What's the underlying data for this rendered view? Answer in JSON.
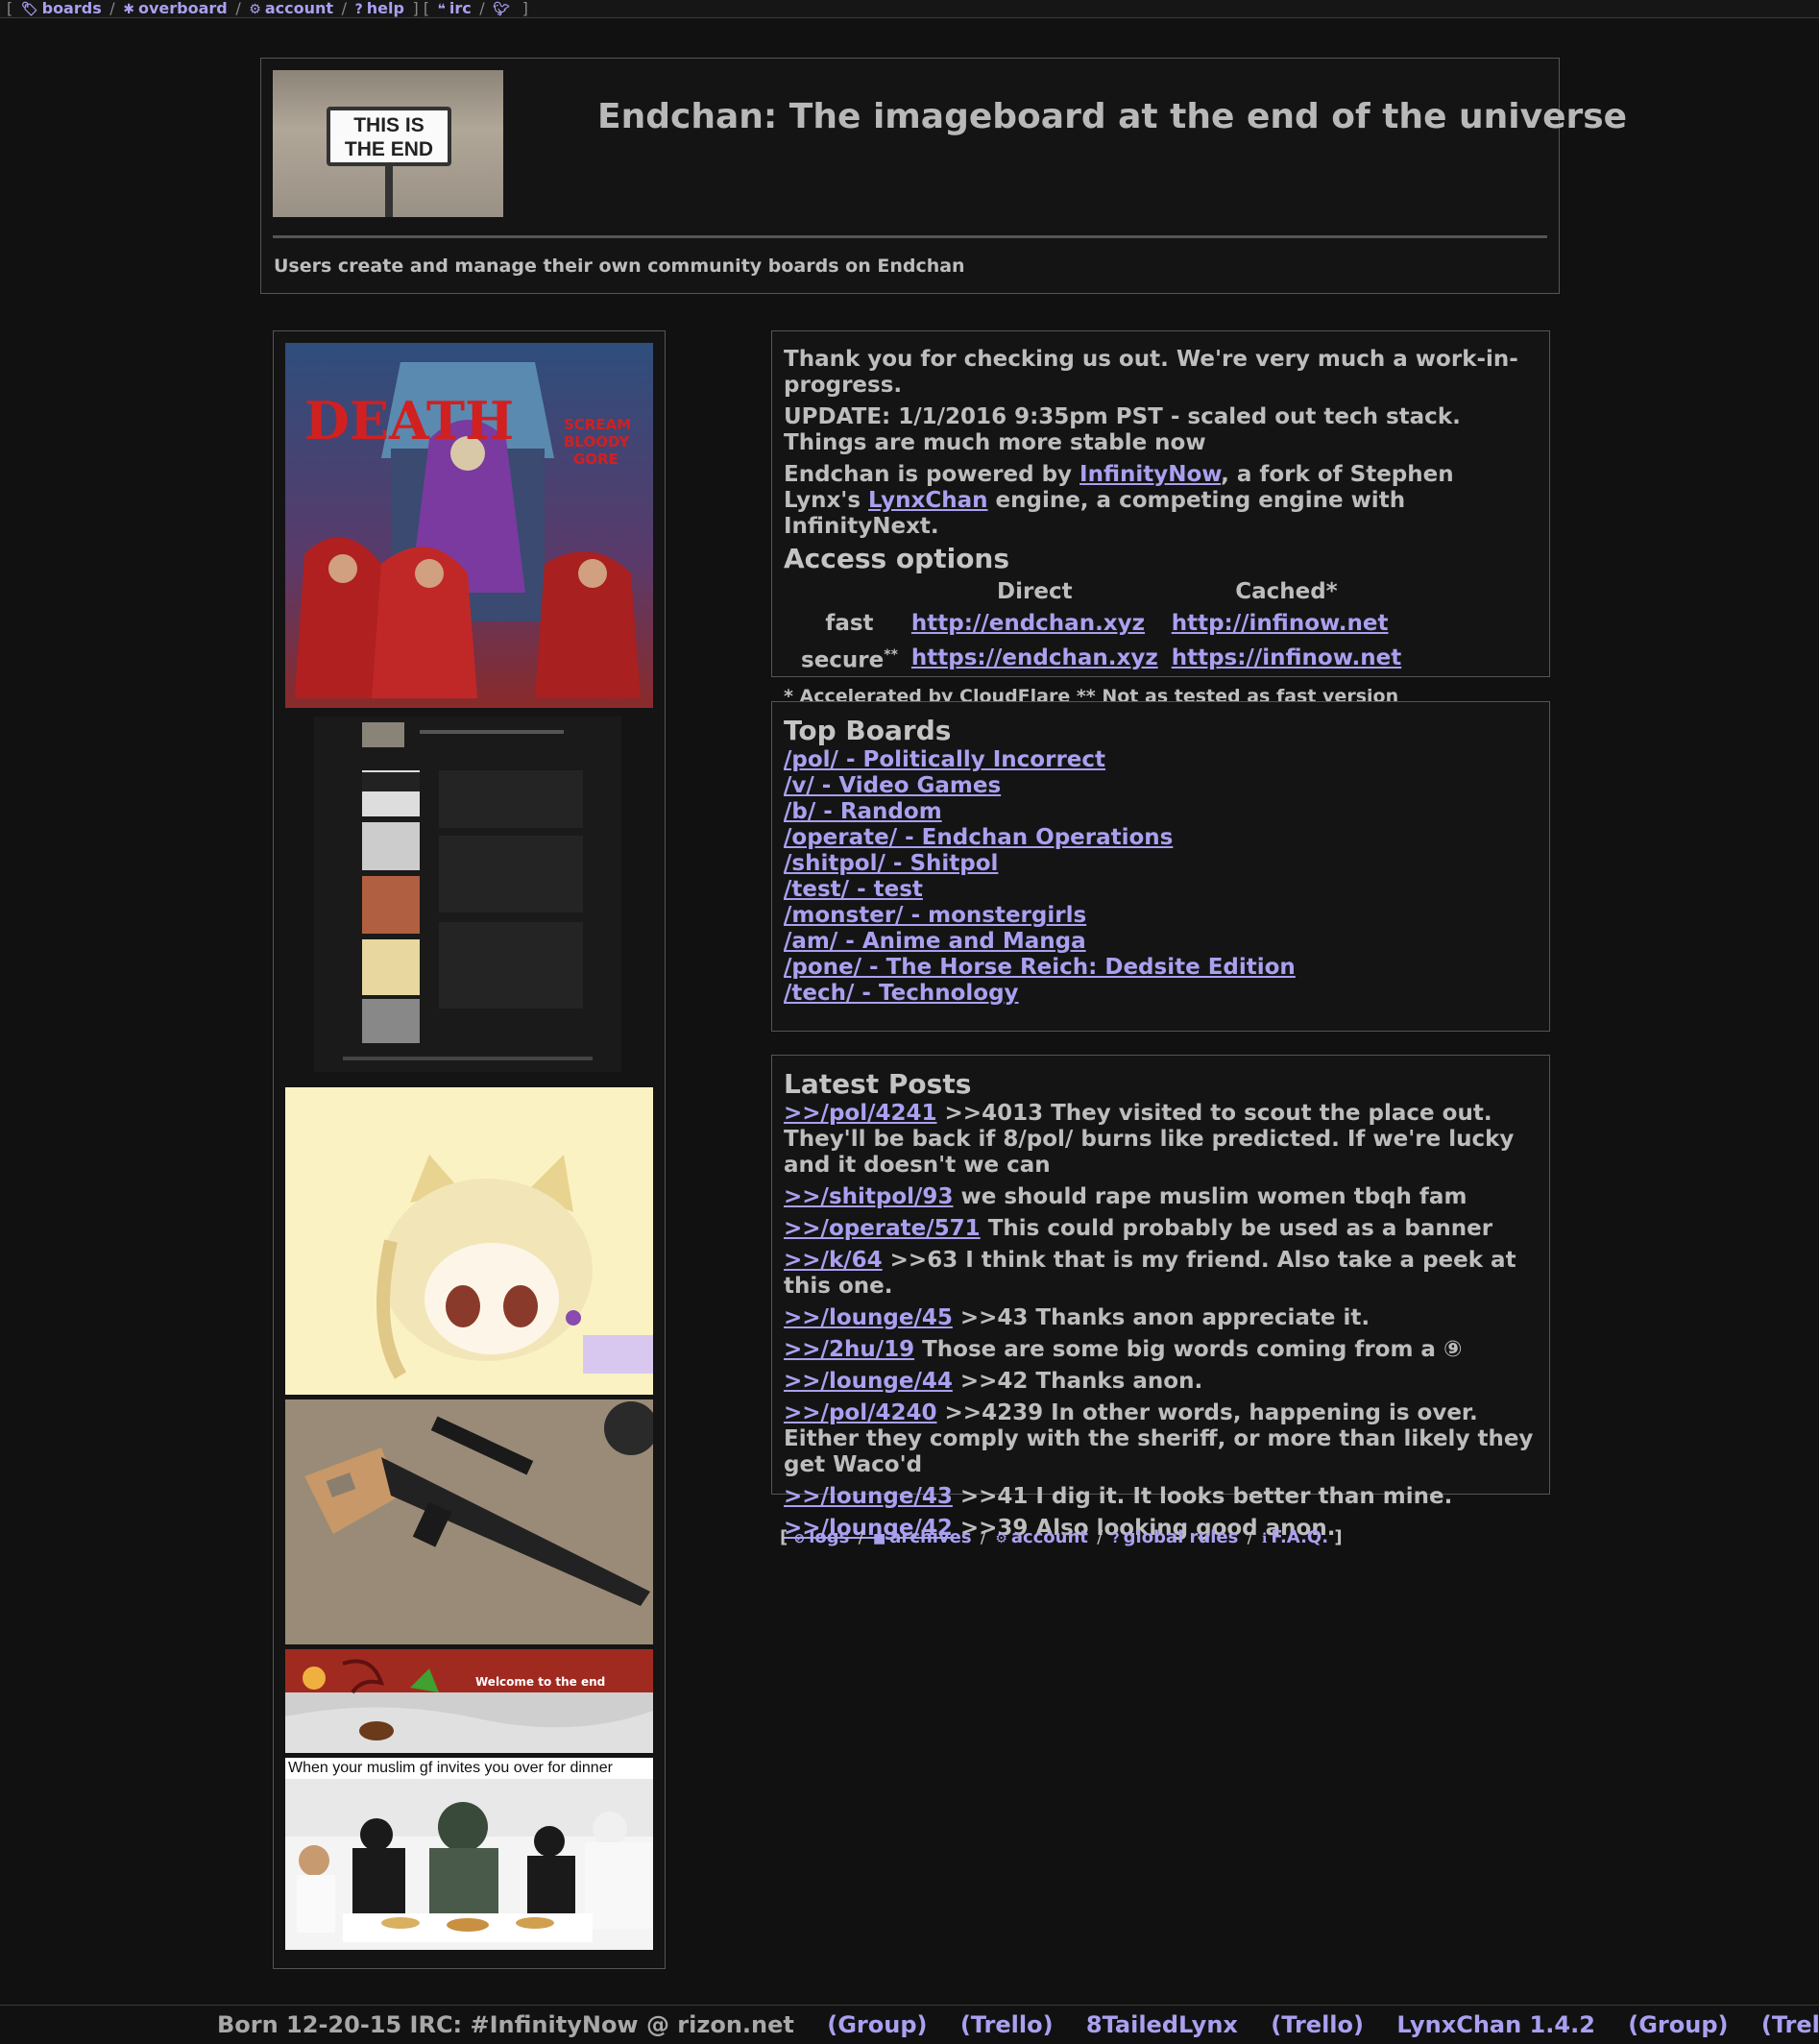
{
  "topnav": {
    "items": [
      {
        "icon": "tag-icon",
        "label": "boards"
      },
      {
        "icon": "asterisk-icon",
        "label": "overboard"
      },
      {
        "icon": "gear-icon",
        "label": "account"
      },
      {
        "icon": "question-icon",
        "label": "help"
      },
      {
        "icon": "quote-icon",
        "label": "irc"
      },
      {
        "icon": "twitter-icon",
        "label": ""
      }
    ]
  },
  "header": {
    "banner_text_line1": "THIS IS",
    "banner_text_line2": "THE END",
    "title": "Endchan: The imageboard at the end of the universe",
    "subtitle": "Users create and manage their own community boards on Endchan"
  },
  "left_images": {
    "img5_caption": "Welcome to the end",
    "img6_caption": "When your muslim gf invites you over for dinner"
  },
  "info": {
    "line1": "Thank you for checking us out. We're very much a work-in-progress.",
    "line2": "UPDATE: 1/1/2016 9:35pm PST - scaled out tech stack. Things are much more stable now",
    "powered_pre": "Endchan is powered by ",
    "powered_link1": "InfinityNow",
    "powered_mid": ", a fork of Stephen Lynx's ",
    "powered_link2": "LynxChan",
    "powered_post": " engine, a competing engine with InfinityNext.",
    "access_title": "Access options",
    "col_direct": "Direct",
    "col_cached": "Cached*",
    "row_fast": "fast",
    "row_secure": "secure",
    "row_secure_sup": "**",
    "fast_direct": "http://endchan.xyz",
    "fast_cached": "http://infinow.net",
    "secure_direct": "https://endchan.xyz",
    "secure_cached": "https://infinow.net",
    "note": "* Accelerated by CloudFlare ** Not as tested as fast version"
  },
  "top_boards": {
    "title": "Top Boards",
    "items": [
      "/pol/ - Politically Incorrect",
      "/v/ - Video Games",
      "/b/ - Random",
      "/operate/ - Endchan Operations",
      "/shitpol/ - Shitpol",
      "/test/ - test",
      "/monster/ - monstergirls",
      "/am/ - Anime and Manga",
      "/pone/ - The Horse Reich: Dedsite Edition",
      "/tech/ - Technology"
    ]
  },
  "latest_posts": {
    "title": "Latest Posts",
    "items": [
      {
        "link": ">>/pol/4241",
        "text": " >>4013 They visited to scout the place out. They'll be back if 8/pol/ burns like predicted. If we're lucky and it doesn't we can"
      },
      {
        "link": ">>/shitpol/93",
        "text": " we should rape muslim women tbqh fam"
      },
      {
        "link": ">>/operate/571",
        "text": " This could probably be used as a banner"
      },
      {
        "link": ">>/k/64",
        "text": " >>63 I think that is my friend. Also take a peek at this one."
      },
      {
        "link": ">>/lounge/45",
        "text": " >>43 Thanks anon appreciate it."
      },
      {
        "link": ">>/2hu/19",
        "text": " Those are some big words coming from a ⑨"
      },
      {
        "link": ">>/lounge/44",
        "text": " >>42 Thanks anon."
      },
      {
        "link": ">>/pol/4240",
        "text": " >>4239 In other words, happening is over. Either they comply with the sheriff, or more than likely they get Waco'd"
      },
      {
        "link": ">>/lounge/43",
        "text": " >>41 I dig it. It looks better than mine."
      },
      {
        "link": ">>/lounge/42",
        "text": " >>39 Also looking good anon."
      }
    ]
  },
  "footnav": {
    "items": [
      {
        "icon": "ban-icon",
        "label": "logs"
      },
      {
        "icon": "archive-icon",
        "label": "archives"
      },
      {
        "icon": "gear-icon",
        "label": "account"
      },
      {
        "icon": "question-icon",
        "label": "global rules"
      },
      {
        "icon": "info-icon",
        "label": "F.A.Q."
      }
    ]
  },
  "bottombar": {
    "text": "Born 12-20-15 IRC: #InfinityNow @ rizon.net",
    "links": [
      "(Group)",
      "(Trello)",
      "8TailedLynx",
      "(Trello)",
      "LynxChan 1.4.2",
      "(Group)",
      "(Trello)"
    ]
  },
  "colors": {
    "background": "#111111",
    "link": "#a9a0f0",
    "text": "#c8c8c8",
    "border": "#555555"
  }
}
